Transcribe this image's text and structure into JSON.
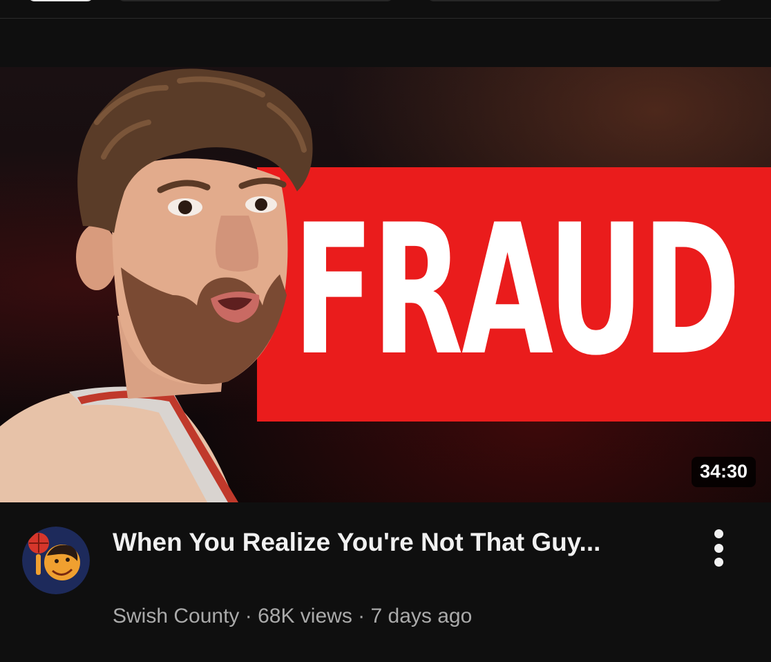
{
  "video": {
    "thumbnail_text": "FRAUD",
    "duration": "34:30",
    "title": "When You Realize You're Not That Guy...",
    "channel": "Swish County",
    "views": "68K views",
    "age": "7 days ago",
    "separator": " · "
  },
  "icons": {
    "more_menu": "more-vert-icon",
    "channel_avatar": "cartoon-basketball-avatar"
  },
  "colors": {
    "background": "#0f0f0f",
    "banner_red": "#ea1c1c",
    "title_text": "#f1f1f1",
    "meta_text": "#aaaaaa"
  }
}
